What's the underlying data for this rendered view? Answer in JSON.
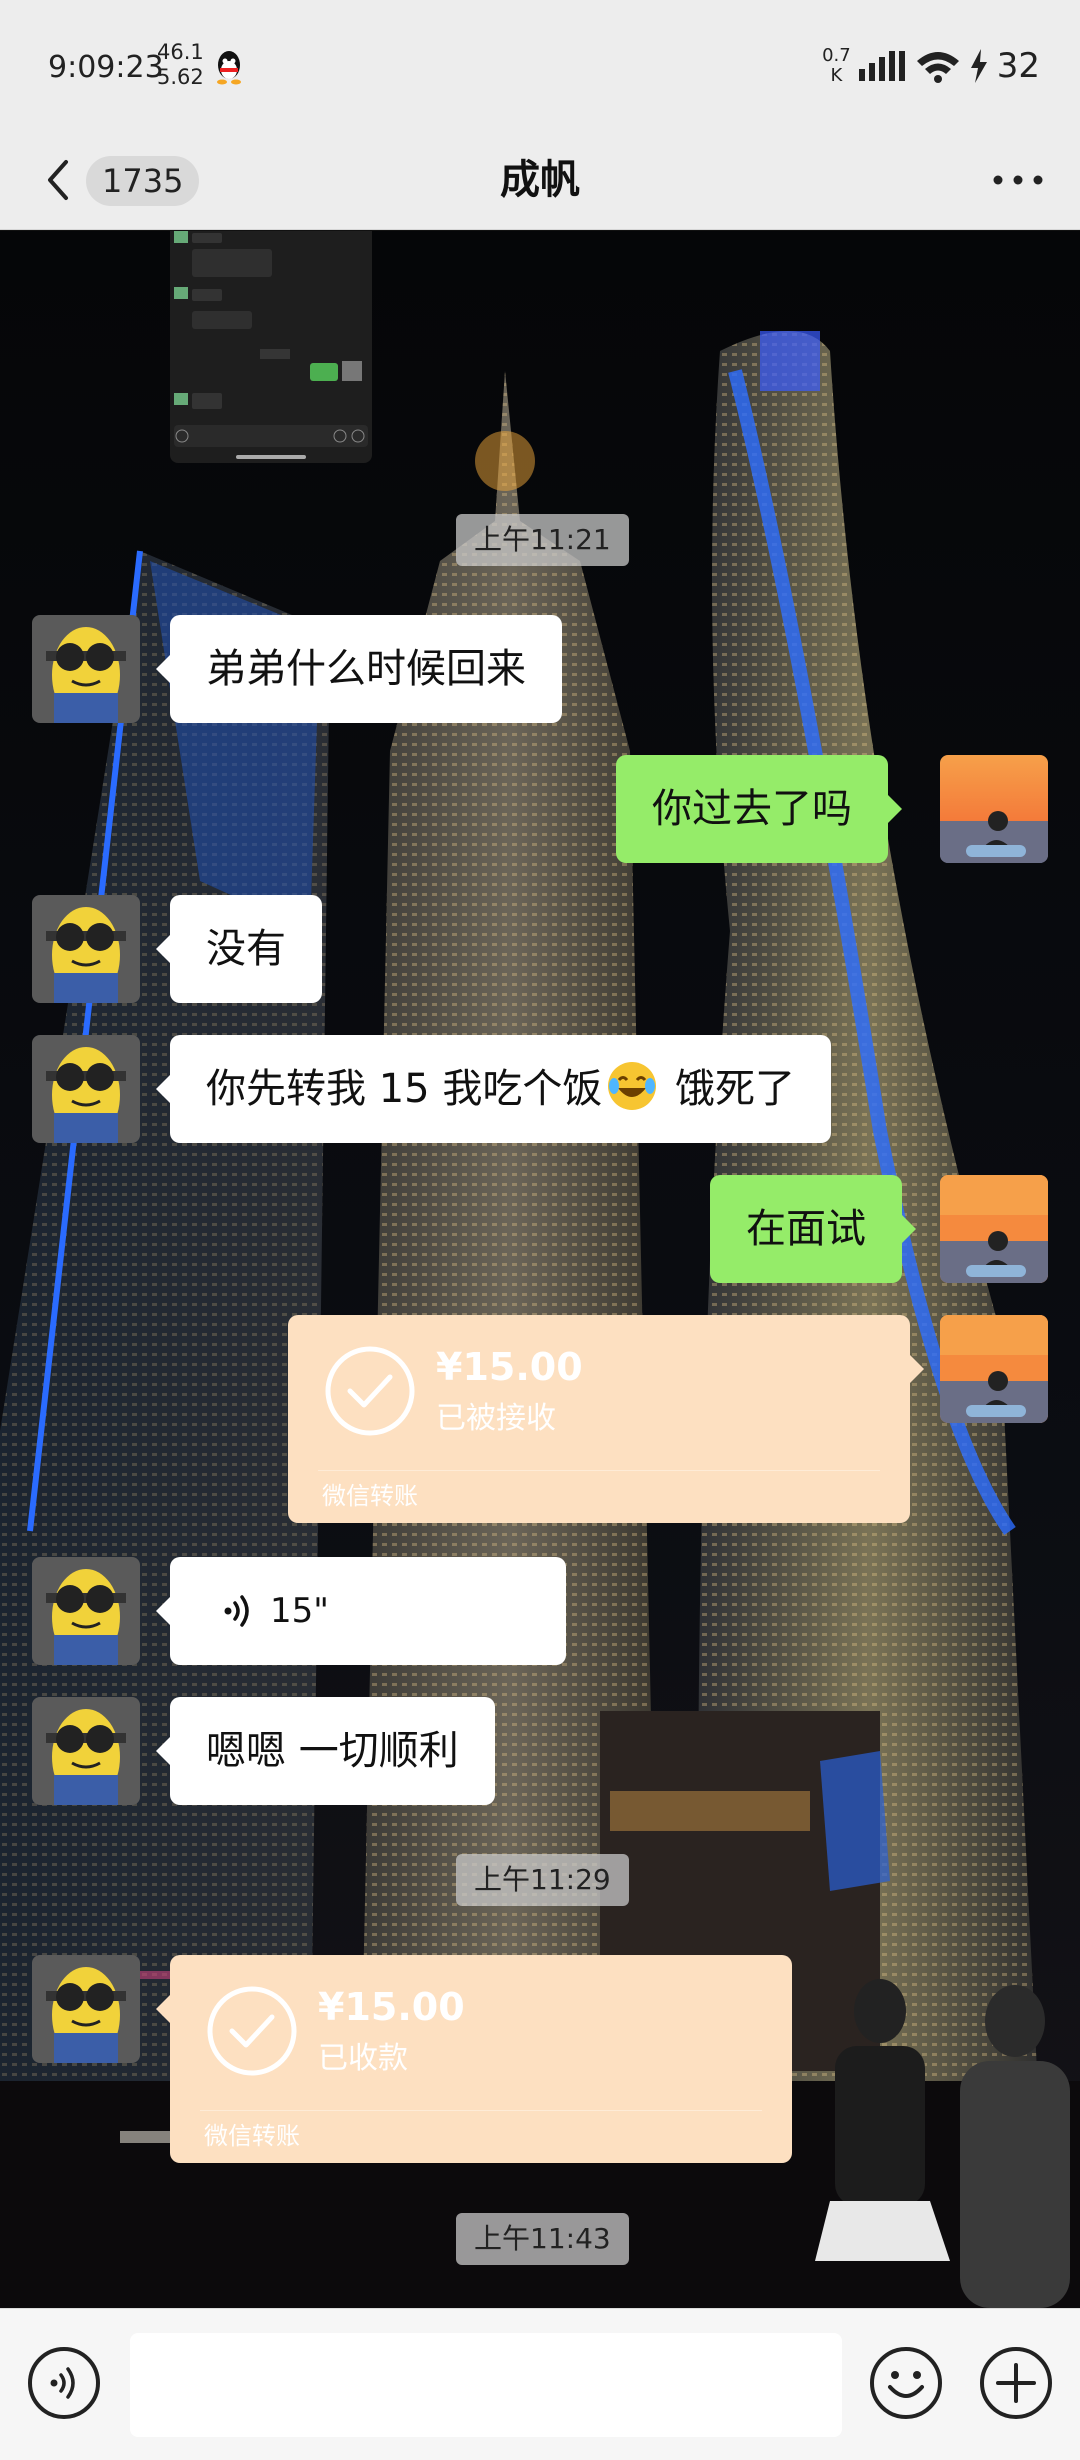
{
  "status_bar": {
    "time": "9:09:23",
    "net_top": "46.1",
    "net_bottom": "5.62",
    "speed_top": "0.7",
    "speed_bottom": "K",
    "battery": "32"
  },
  "nav": {
    "unread_badge": "1735",
    "title": "成帆"
  },
  "messages": {
    "ts1": "上午11:21",
    "m1": "弟弟什么时候回来",
    "m2": "你过去了吗",
    "m3": "没有",
    "m4_a": "你先转我 15 我吃个饭",
    "m4_b": " 饿死了",
    "m5": "在面试",
    "transfer1": {
      "amount": "¥15.00",
      "status": "已被接收",
      "label": "微信转账"
    },
    "voice": {
      "duration": "15\""
    },
    "m7": "嗯嗯 一切顺利",
    "ts2": "上午11:29",
    "transfer2": {
      "amount": "¥15.00",
      "status": "已收款",
      "label": "微信转账"
    },
    "ts3": "上午11:43"
  },
  "input": {
    "placeholder": ""
  },
  "colors": {
    "chat_green": "#95ec69",
    "transfer_orange": "#fde0c1",
    "bar_gray": "#ededed"
  },
  "icons": [
    "back-arrow-icon",
    "more-icon",
    "qq-icon",
    "signal-icon",
    "wifi-icon",
    "charging-icon",
    "voice-icon",
    "emoji-icon",
    "plus-icon",
    "check-circle-icon",
    "laugh-cry-emoji"
  ]
}
